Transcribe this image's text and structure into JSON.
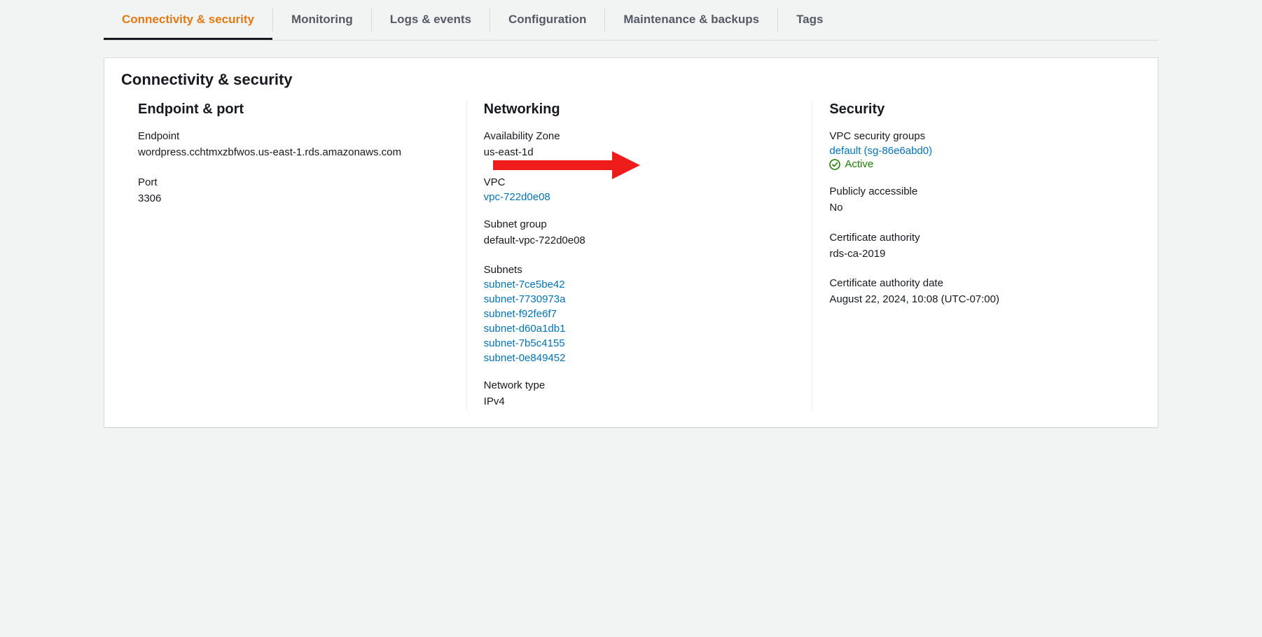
{
  "tabs": [
    {
      "label": "Connectivity & security",
      "active": true
    },
    {
      "label": "Monitoring",
      "active": false
    },
    {
      "label": "Logs & events",
      "active": false
    },
    {
      "label": "Configuration",
      "active": false
    },
    {
      "label": "Maintenance & backups",
      "active": false
    },
    {
      "label": "Tags",
      "active": false
    }
  ],
  "panel_title": "Connectivity & security",
  "endpoint_port": {
    "heading": "Endpoint & port",
    "endpoint_label": "Endpoint",
    "endpoint_value": "wordpress.cchtmxzbfwos.us-east-1.rds.amazonaws.com",
    "port_label": "Port",
    "port_value": "3306"
  },
  "networking": {
    "heading": "Networking",
    "az_label": "Availability Zone",
    "az_value": "us-east-1d",
    "vpc_label": "VPC",
    "vpc_link": "vpc-722d0e08",
    "subnet_group_label": "Subnet group",
    "subnet_group_value": "default-vpc-722d0e08",
    "subnets_label": "Subnets",
    "subnets": [
      "subnet-7ce5be42",
      "subnet-7730973a",
      "subnet-f92fe6f7",
      "subnet-d60a1db1",
      "subnet-7b5c4155",
      "subnet-0e849452"
    ],
    "network_type_label": "Network type",
    "network_type_value": "IPv4"
  },
  "security": {
    "heading": "Security",
    "sg_label": "VPC security groups",
    "sg_link": "default (sg-86e6abd0)",
    "sg_status": "Active",
    "public_label": "Publicly accessible",
    "public_value": "No",
    "ca_label": "Certificate authority",
    "ca_value": "rds-ca-2019",
    "ca_date_label": "Certificate authority date",
    "ca_date_value": "August 22, 2024, 10:08 (UTC-07:00)"
  }
}
